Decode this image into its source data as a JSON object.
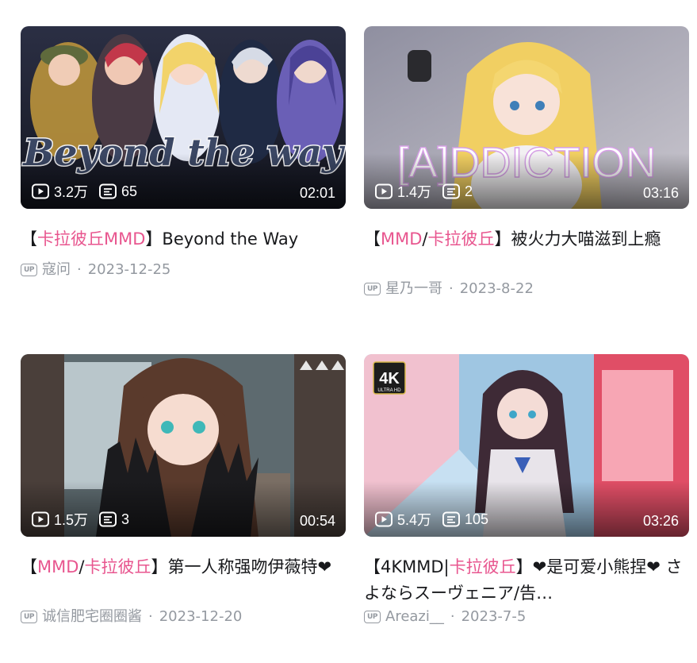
{
  "videos": [
    {
      "title_parts": [
        {
          "text": "【",
          "hl": false
        },
        {
          "text": "卡拉彼丘MMD",
          "hl": true
        },
        {
          "text": "】Beyond the Way",
          "hl": false
        }
      ],
      "plays": "3.2万",
      "danmaku": "65",
      "duration": "02:01",
      "up_label": "UP",
      "author": "寇问",
      "date": "2023-12-25",
      "thumb_text": "Beyond the way"
    },
    {
      "title_parts": [
        {
          "text": "【",
          "hl": false
        },
        {
          "text": "MMD",
          "hl": true
        },
        {
          "text": "/",
          "hl": false
        },
        {
          "text": "卡拉彼丘",
          "hl": true
        },
        {
          "text": "】被火力大喵滋到上瘾",
          "hl": false
        }
      ],
      "plays": "1.4万",
      "danmaku": "2",
      "duration": "03:16",
      "up_label": "UP",
      "author": "星乃一哥",
      "date": "2023-8-22",
      "thumb_text": "[A]DDICTION"
    },
    {
      "title_parts": [
        {
          "text": "【",
          "hl": false
        },
        {
          "text": "MMD",
          "hl": true
        },
        {
          "text": "/",
          "hl": false
        },
        {
          "text": "卡拉彼丘",
          "hl": true
        },
        {
          "text": "】第一人称强吻伊薇特❤",
          "hl": false
        }
      ],
      "plays": "1.5万",
      "danmaku": "3",
      "duration": "00:54",
      "up_label": "UP",
      "author": "诚信肥宅圈圈酱",
      "date": "2023-12-20",
      "thumb_text": ""
    },
    {
      "title_parts": [
        {
          "text": "【4KMMD|",
          "hl": false
        },
        {
          "text": "卡拉彼丘",
          "hl": true
        },
        {
          "text": "】❤是可爱小熊捏❤ さよならスーヴェニア/告…",
          "hl": false
        }
      ],
      "plays": "5.4万",
      "danmaku": "105",
      "duration": "03:26",
      "up_label": "UP",
      "author": "Areazi__",
      "date": "2023-7-5",
      "thumb_text": "4K",
      "badge_sub": "ULTRA HD"
    }
  ]
}
